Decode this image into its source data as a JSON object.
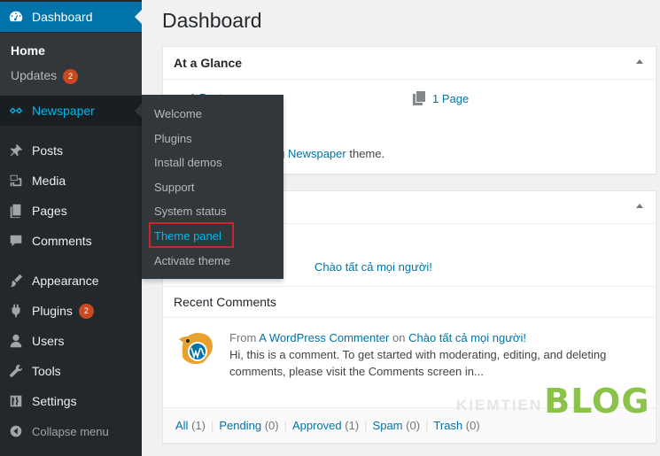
{
  "sidebar": {
    "dashboard": "Dashboard",
    "home": "Home",
    "updates": "Updates",
    "updates_count": "2",
    "newspaper": "Newspaper",
    "posts": "Posts",
    "media": "Media",
    "pages": "Pages",
    "comments": "Comments",
    "appearance": "Appearance",
    "plugins": "Plugins",
    "plugins_count": "2",
    "users": "Users",
    "tools": "Tools",
    "settings": "Settings",
    "collapse": "Collapse menu"
  },
  "flyout": {
    "items": [
      "Welcome",
      "Plugins",
      "Install demos",
      "Support",
      "System status",
      "Theme panel",
      "Activate theme"
    ]
  },
  "main": {
    "title": "Dashboard",
    "glance": {
      "title": "At a Glance",
      "posts_partial": "1 Post",
      "pages": "1 Page",
      "theme_prefix": "ing ",
      "theme_link": "Newspaper",
      "theme_suffix": " theme."
    },
    "activity": {
      "post_link": "Chào tất cả mọi người!",
      "recent_comments": "Recent Comments",
      "from": "From",
      "author": "A WordPress Commenter",
      "on": "on",
      "post": "Chào tất cả mọi người!",
      "comment_text": "Hi, this is a comment. To get started with moderating, editing, and deleting comments, please visit the Comments screen in...",
      "filters": [
        {
          "label": "All",
          "count": "(1)"
        },
        {
          "label": "Pending",
          "count": "(0)"
        },
        {
          "label": "Approved",
          "count": "(1)"
        },
        {
          "label": "Spam",
          "count": "(0)"
        },
        {
          "label": "Trash",
          "count": "(0)"
        }
      ]
    }
  },
  "watermark": {
    "small": "KIEMTIEN",
    "big": "BLOG"
  },
  "colors": {
    "sidebar": "#23282d",
    "active": "#0073aa",
    "link": "#0073aa",
    "badge": "#ca4a1f",
    "highlight_box": "#d0262b",
    "blog_green": "#8ac24a"
  }
}
